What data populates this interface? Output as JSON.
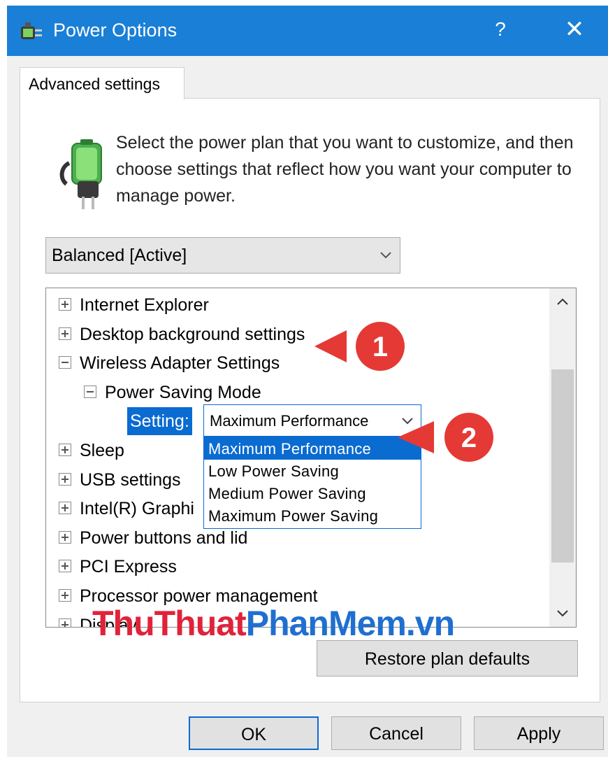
{
  "window": {
    "title": "Power Options",
    "help_label": "?",
    "close_label": "✕",
    "accent": "#1a7fd6"
  },
  "tab": {
    "label": "Advanced settings"
  },
  "description": "Select the power plan that you want to customize, and then choose settings that reflect how you want your computer to manage power.",
  "plan_select": {
    "value": "Balanced [Active]"
  },
  "tree": {
    "items": [
      {
        "label": "Internet Explorer",
        "expanded": false
      },
      {
        "label": "Desktop background settings",
        "expanded": false
      },
      {
        "label": "Wireless Adapter Settings",
        "expanded": true
      },
      {
        "label": "Power Saving Mode",
        "expanded": true
      },
      {
        "label": "Sleep",
        "expanded": false
      },
      {
        "label": "USB settings",
        "expanded": false
      },
      {
        "label": "Intel(R) Graphi",
        "expanded": false
      },
      {
        "label": "Power buttons and lid",
        "expanded": false
      },
      {
        "label": "PCI Express",
        "expanded": false
      },
      {
        "label": "Processor power management",
        "expanded": false
      },
      {
        "label": "Display",
        "expanded": false
      }
    ],
    "setting_label": "Setting:",
    "setting_value": "Maximum Performance",
    "options": [
      "Maximum Performance",
      "Low Power Saving",
      "Medium Power Saving",
      "Maximum Power Saving"
    ],
    "selected_option": "Maximum Performance"
  },
  "buttons": {
    "restore": "Restore plan defaults",
    "ok": "OK",
    "cancel": "Cancel",
    "apply": "Apply"
  },
  "annotations": [
    {
      "number": "1",
      "color": "#e53935"
    },
    {
      "number": "2",
      "color": "#e53935"
    }
  ],
  "watermark": {
    "part1": "ThuThuat",
    "part2": "PhanMem",
    "part3": ".vn"
  }
}
